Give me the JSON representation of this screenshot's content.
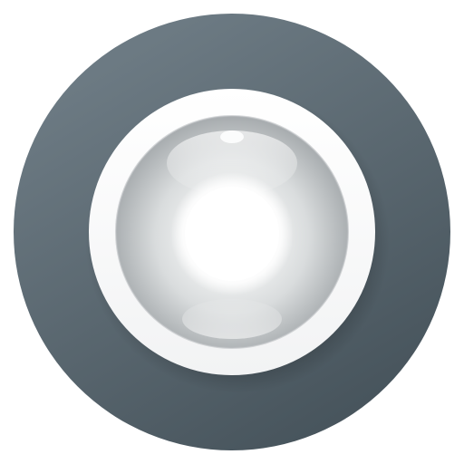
{
  "icon": {
    "name": "camera-lens-icon",
    "colors": {
      "outer_disc_light": "#6c7a83",
      "outer_disc_dark": "#47545c",
      "ring": "#f7f8f9",
      "lens_light": "#e8eaeb",
      "lens_dark": "#9ea3a6",
      "highlight": "#ffffff"
    }
  }
}
